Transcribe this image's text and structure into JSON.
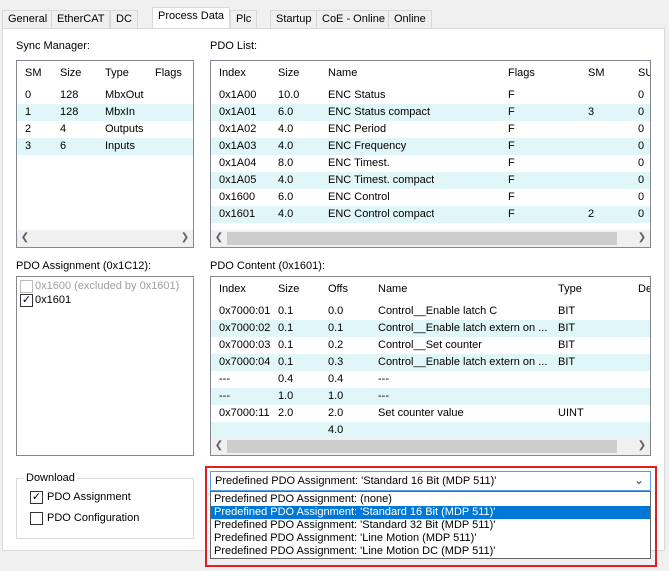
{
  "tabs": [
    "General",
    "EtherCAT",
    "DC",
    "Process Data",
    "Plc",
    "Startup",
    "CoE - Online",
    "Online"
  ],
  "sync_manager": {
    "label": "Sync Manager:",
    "columns": [
      "SM",
      "Size",
      "Type",
      "Flags"
    ],
    "rows": [
      [
        "0",
        "128",
        "MbxOut",
        ""
      ],
      [
        "1",
        "128",
        "MbxIn",
        ""
      ],
      [
        "2",
        "4",
        "Outputs",
        ""
      ],
      [
        "3",
        "6",
        "Inputs",
        ""
      ]
    ]
  },
  "pdo_list": {
    "label": "PDO List:",
    "columns": [
      "Index",
      "Size",
      "Name",
      "Flags",
      "SM",
      "SU"
    ],
    "rows": [
      [
        "0x1A00",
        "10.0",
        "ENC Status",
        "F",
        "",
        "0"
      ],
      [
        "0x1A01",
        "6.0",
        "ENC Status compact",
        "F",
        "3",
        "0"
      ],
      [
        "0x1A02",
        "4.0",
        "ENC Period",
        "F",
        "",
        "0"
      ],
      [
        "0x1A03",
        "4.0",
        "ENC Frequency",
        "F",
        "",
        "0"
      ],
      [
        "0x1A04",
        "8.0",
        "ENC Timest.",
        "F",
        "",
        "0"
      ],
      [
        "0x1A05",
        "4.0",
        "ENC Timest. compact",
        "F",
        "",
        "0"
      ],
      [
        "0x1600",
        "6.0",
        "ENC Control",
        "F",
        "",
        "0"
      ],
      [
        "0x1601",
        "4.0",
        "ENC Control compact",
        "F",
        "2",
        "0"
      ]
    ]
  },
  "pdo_assignment": {
    "label": "PDO Assignment (0x1C12):",
    "items": [
      {
        "label": "0x1600 (excluded by 0x1601)",
        "checked": false,
        "disabled": true
      },
      {
        "label": "0x1601",
        "checked": true,
        "disabled": false
      }
    ]
  },
  "pdo_content": {
    "label": "PDO Content (0x1601):",
    "columns": [
      "Index",
      "Size",
      "Offs",
      "Name",
      "Type",
      "De"
    ],
    "rows": [
      [
        "0x7000:01",
        "0.1",
        "0.0",
        "Control__Enable latch C",
        "BIT",
        ""
      ],
      [
        "0x7000:02",
        "0.1",
        "0.1",
        "Control__Enable latch extern on ...",
        "BIT",
        ""
      ],
      [
        "0x7000:03",
        "0.1",
        "0.2",
        "Control__Set counter",
        "BIT",
        ""
      ],
      [
        "0x7000:04",
        "0.1",
        "0.3",
        "Control__Enable latch extern on ...",
        "BIT",
        ""
      ],
      [
        "---",
        "0.4",
        "0.4",
        "---",
        "",
        ""
      ],
      [
        "---",
        "1.0",
        "1.0",
        "---",
        "",
        ""
      ],
      [
        "0x7000:11",
        "2.0",
        "2.0",
        "Set counter value",
        "UINT",
        ""
      ],
      [
        "",
        "",
        "4.0",
        "",
        "",
        ""
      ]
    ]
  },
  "download": {
    "label": "Download",
    "pdo_assignment_label": "PDO Assignment",
    "pdo_assignment_checked": true,
    "pdo_configuration_label": "PDO Configuration",
    "pdo_configuration_checked": false
  },
  "predefined": {
    "selected": "Predefined PDO Assignment: 'Standard 16 Bit (MDP 511)'",
    "options": [
      "Predefined PDO Assignment: (none)",
      "Predefined PDO Assignment: 'Standard 16 Bit (MDP 511)'",
      "Predefined PDO Assignment: 'Standard 32 Bit (MDP 511)'",
      "Predefined PDO Assignment: 'Line Motion (MDP 511)'",
      "Predefined PDO Assignment: 'Line Motion DC (MDP 511)'"
    ],
    "highlighted_index": 1,
    "highlight_color": "#e02020"
  }
}
